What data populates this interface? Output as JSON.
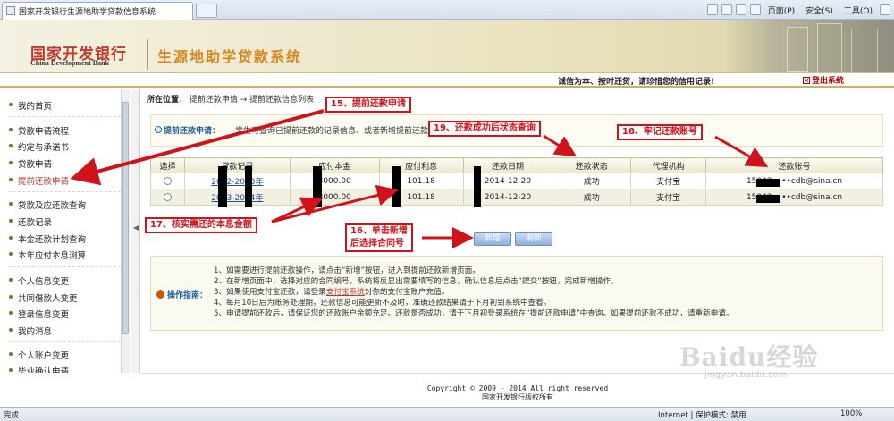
{
  "browser": {
    "tab_title": "国家开发银行生源地助学贷款信息系统",
    "toolbar": {
      "page": "页面(P)",
      "safety": "安全(S)",
      "tools": "工具(O)"
    }
  },
  "header": {
    "bank_name_cn": "国家开发银行",
    "bank_name_en": "China Development Bank",
    "system_title": "生源地助学贷款系统",
    "slogan": "诚信为本、按时还贷，请珍惜您的信用记录!",
    "logout": "登出系统"
  },
  "sidebar": {
    "items": [
      {
        "label": "我的首页"
      },
      {
        "label": "贷款申请流程"
      },
      {
        "label": "约定与承诺书"
      },
      {
        "label": "贷款申请"
      },
      {
        "label": "提前还款申请"
      },
      {
        "label": "贷款及应还款查询"
      },
      {
        "label": "还款记录"
      },
      {
        "label": "本金还款计划查询"
      },
      {
        "label": "本年应付本息测算"
      },
      {
        "label": "个人信息变更"
      },
      {
        "label": "共同借款人变更"
      },
      {
        "label": "登录信息变更"
      },
      {
        "label": "我的消息"
      },
      {
        "label": "个人账户变更"
      },
      {
        "label": "毕业确认申请"
      }
    ]
  },
  "main": {
    "location_label": "所在位置：",
    "breadcrumb": "提前还款申请 → 提前还款信息列表",
    "notice_title": "提前还款申请：",
    "notice_text": "学生可查询已提前还款的记录信息、或者新增提前还款申请。",
    "table": {
      "columns": [
        "选择",
        "贷款记录",
        "应付本金",
        "应付利息",
        "还款日期",
        "还款状态",
        "代理机构",
        "还款账号"
      ],
      "rows": [
        {
          "record": "2012-2013年",
          "principal": "3000.00",
          "interest": "101.18",
          "date": "2014-12-20",
          "status": "成功",
          "agent": "支付宝",
          "account": "15042••••cdb@sina.cn"
        },
        {
          "record": "2013-2014年",
          "principal": "3000.00",
          "interest": "101.18",
          "date": "2014-12-20",
          "status": "成功",
          "agent": "支付宝",
          "account": "15042••••cdb@sina.cn"
        }
      ]
    },
    "buttons": {
      "add": "新增",
      "refresh": "刷新"
    },
    "guide": {
      "title": "操作指南：",
      "lines": [
        "1、如需要进行提前还款操作，请点击“新增”按钮，进入到提前还款新增页面。",
        "2、在新增页面中，选择对应的合同编号，系统将反显出需要填写的信息，确认信息后点击“提交”按钮，完成新增操作。",
        "3、如果使用支付宝还款，请登录",
        "4、每月10日后为账务处理期，还款信息可能更新不及时，准确还款结果请于下月初到系统中查看。",
        "5、申请提前还款后，请保证您的还款账户余额充足。还款是否成功，请于下月初登录系统在“提前还款申请”中查询。如果提前还款不成功，请重新申请。"
      ],
      "line3_link": "支付宝系统",
      "line3_tail": "对你的支付宝账户充值。"
    }
  },
  "footer": {
    "copyright": "Copyright © 2009 - 2014 All right reserved",
    "owner": "国家开发银行版权所有"
  },
  "status_bar": {
    "left": "完成",
    "zone": "Internet | 保护模式: 禁用",
    "zoom": "100%"
  },
  "watermark": {
    "main": "Baidu经验",
    "sub": "jingyan.baidu.com"
  },
  "annotations": {
    "a15": "15、提前还款申请",
    "a16_line1": "16、单击新增",
    "a16_line2": "后选择合同号",
    "a17": "17、核实需还的本息金额",
    "a18": "18、牢记还款账号",
    "a19": "19、还款成功后状态查询"
  },
  "colors": {
    "annotation_red": "#d0131a",
    "brand_red": "#c0392b",
    "title_orange": "#d4861f"
  }
}
